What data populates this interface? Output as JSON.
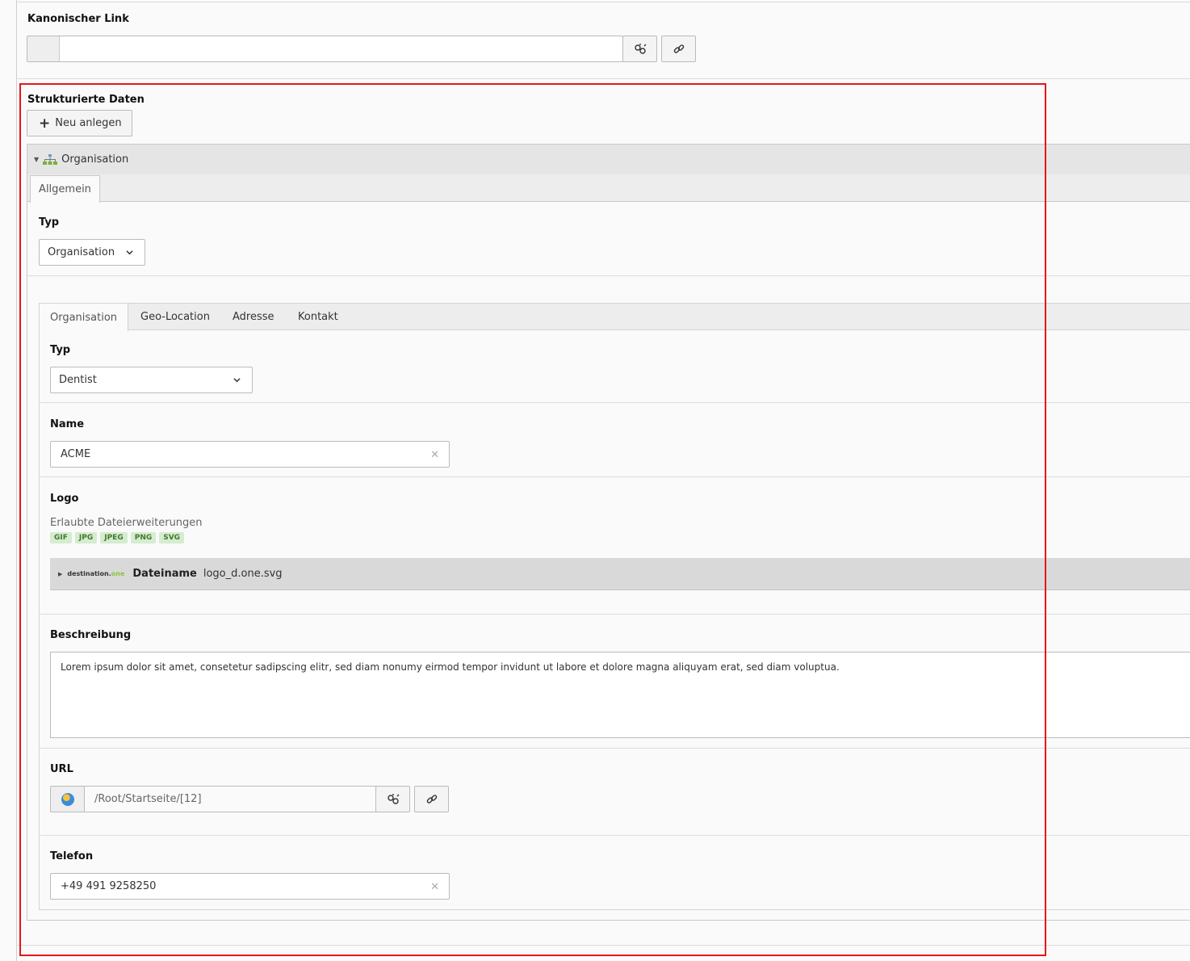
{
  "canonical": {
    "label": "Kanonischer Link",
    "value": ""
  },
  "structured": {
    "label": "Strukturierte Daten",
    "new_button": "Neu anlegen",
    "item_title": "Organisation",
    "outer_tab": "Allgemein",
    "type_label": "Typ",
    "type_value": "Organisation",
    "inner_tabs": [
      "Organisation",
      "Geo-Location",
      "Adresse",
      "Kontakt"
    ],
    "org": {
      "type_label": "Typ",
      "type_value": "Dentist",
      "name_label": "Name",
      "name_value": "ACME",
      "logo_label": "Logo",
      "logo_hint": "Erlaubte Dateierweiterungen",
      "extensions": [
        "GIF",
        "JPG",
        "JPEG",
        "PNG",
        "SVG"
      ],
      "file_logo_text": "destination.",
      "file_logo_text2": "one",
      "file_label": "Dateiname",
      "file_name": "logo_d.one.svg",
      "desc_label": "Beschreibung",
      "desc_value": "Lorem ipsum dolor sit amet, consetetur sadipscing elitr, sed diam nonumy eirmod tempor invidunt ut labore et dolore magna aliquyam erat, sed diam voluptua.",
      "url_label": "URL",
      "url_value": "/Root/Startseite/[12]",
      "phone_label": "Telefon",
      "phone_value": "+49 491 9258250"
    }
  },
  "colors": {
    "highlight": "#e5161a",
    "badge_bg": "#d6ecd0",
    "badge_text": "#3f7a2c"
  },
  "icons": [
    "unlink-icon",
    "link-icon",
    "plus-icon",
    "caret-down-icon",
    "sitemap-icon",
    "chevron-down-icon",
    "close-icon",
    "caret-right-icon",
    "globe-icon"
  ]
}
